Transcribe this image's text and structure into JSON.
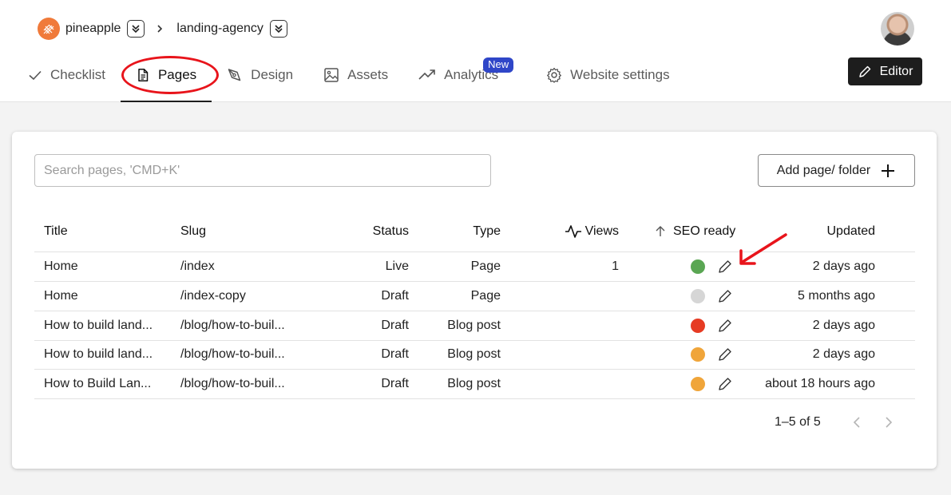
{
  "breadcrumb": {
    "workspace": "pineapple",
    "project": "landing-agency"
  },
  "editor_label": "Editor",
  "tabs": [
    {
      "label": "Checklist",
      "icon": "check-icon"
    },
    {
      "label": "Pages",
      "icon": "document-icon",
      "active": true
    },
    {
      "label": "Design",
      "icon": "pen-tool-icon"
    },
    {
      "label": "Assets",
      "icon": "image-icon"
    },
    {
      "label": "Analytics",
      "icon": "trending-up-icon",
      "badge": "New"
    },
    {
      "label": "Website settings",
      "icon": "gear-icon"
    }
  ],
  "search": {
    "placeholder": "Search pages, 'CMD+K'",
    "value": ""
  },
  "add_button": "Add page/ folder",
  "table": {
    "columns": {
      "title": "Title",
      "slug": "Slug",
      "status": "Status",
      "type": "Type",
      "views": "Views",
      "seo": "SEO ready",
      "updated": "Updated"
    },
    "rows": [
      {
        "title": "Home",
        "slug": "/index",
        "status": "Live",
        "type": "Page",
        "views": "1",
        "seo_color": "#5aa653",
        "updated": "2 days ago"
      },
      {
        "title": "Home",
        "slug": "/index-copy",
        "status": "Draft",
        "type": "Page",
        "views": "",
        "seo_color": "#d6d6d6",
        "updated": "5 months ago"
      },
      {
        "title": "How to build land...",
        "slug": "/blog/how-to-buil...",
        "status": "Draft",
        "type": "Blog post",
        "views": "",
        "seo_color": "#e63b23",
        "updated": "2 days ago"
      },
      {
        "title": "How to build land...",
        "slug": "/blog/how-to-buil...",
        "status": "Draft",
        "type": "Blog post",
        "views": "",
        "seo_color": "#f0a53a",
        "updated": "2 days ago"
      },
      {
        "title": "How to Build Lan...",
        "slug": "/blog/how-to-buil...",
        "status": "Draft",
        "type": "Blog post",
        "views": "",
        "seo_color": "#f0a53a",
        "updated": "about 18 hours ago"
      }
    ]
  },
  "pagination": {
    "range": "1–5 of 5"
  },
  "colors": {
    "accent": "#1d1d1d",
    "badge": "#2f46c8",
    "annotation": "#e8141b",
    "logo": "#f07a3a"
  }
}
